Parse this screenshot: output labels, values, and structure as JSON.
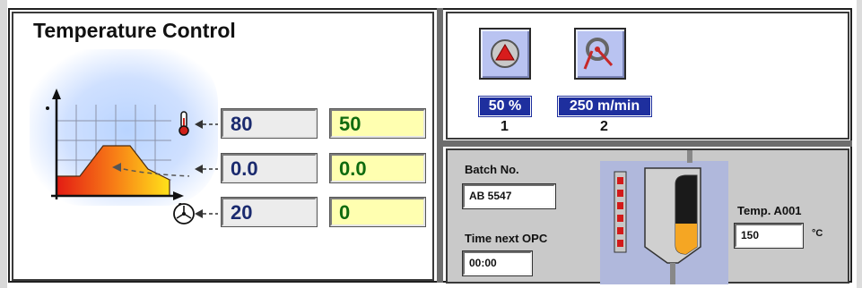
{
  "temperature_control": {
    "title": "Temperature Control",
    "rows": [
      {
        "icon": "thermometer-icon",
        "actual": "80",
        "setpoint": "50"
      },
      {
        "icon": "",
        "actual": "0.0",
        "setpoint": "0.0"
      },
      {
        "icon": "fan-icon",
        "actual": "20",
        "setpoint": "0"
      }
    ]
  },
  "drives": [
    {
      "icon": "warning-triangle-icon",
      "value": "50 %",
      "number": "1"
    },
    {
      "icon": "speed-gauge-icon",
      "value": "250 m/min",
      "number": "2"
    }
  ],
  "batch": {
    "batch_label": "Batch No.",
    "batch_value": "AB 5547",
    "time_label": "Time next OPC",
    "time_value": "00:00",
    "temp_label": "Temp. A001",
    "temp_value": "150",
    "temp_unit": "°C"
  },
  "colors": {
    "value_badge_bg": "#1e2f9e",
    "button_bg": "#b9c3f1",
    "setpoint_bg": "#ffffb0",
    "actual_text": "#1a2a6e",
    "setpoint_text": "#0f6b0f",
    "tank_fill": "#f5a623"
  }
}
